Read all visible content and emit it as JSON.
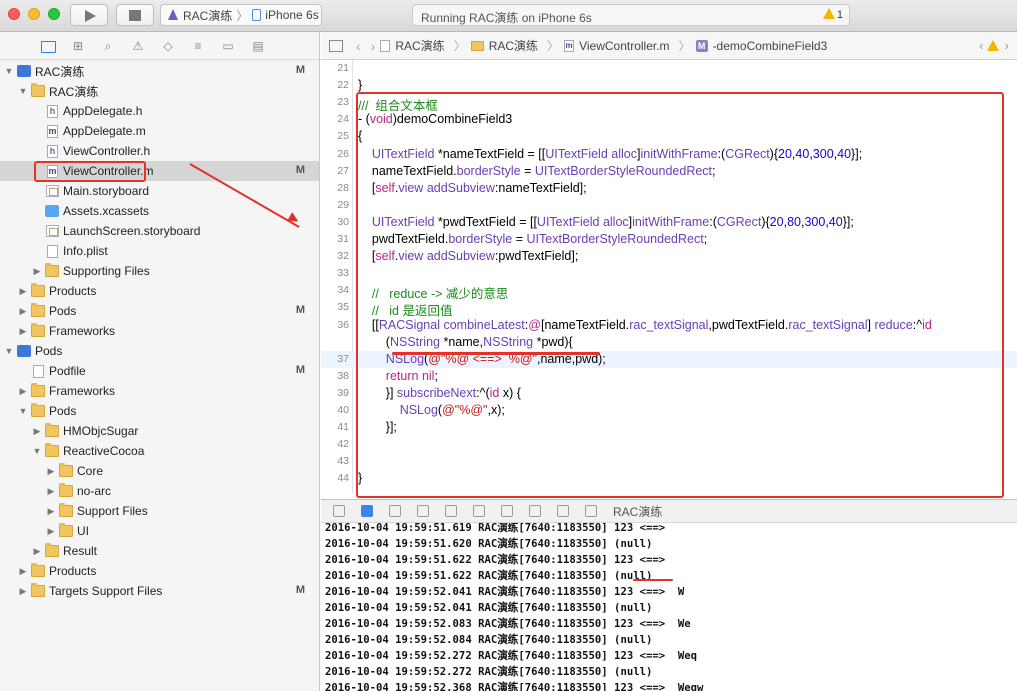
{
  "toolbar": {
    "scheme_target": "RAC演练",
    "scheme_device": "iPhone 6s",
    "status_text": "Running RAC演练 on iPhone 6s",
    "warning_count": "1"
  },
  "navigator": {
    "tree": [
      {
        "label": "RAC演练",
        "indent": 0,
        "icon": "project-icon",
        "disclosure": "▼",
        "badge": "M"
      },
      {
        "label": "RAC演练",
        "indent": 1,
        "icon": "folder-icon",
        "disclosure": "▼",
        "badge": ""
      },
      {
        "label": "AppDelegate.h",
        "indent": 2,
        "icon": "header-file-icon",
        "disclosure": "",
        "badge": ""
      },
      {
        "label": "AppDelegate.m",
        "indent": 2,
        "icon": "objc-file-icon",
        "disclosure": "",
        "badge": ""
      },
      {
        "label": "ViewController.h",
        "indent": 2,
        "icon": "header-file-icon",
        "disclosure": "",
        "badge": ""
      },
      {
        "label": "ViewController.m",
        "indent": 2,
        "icon": "objc-file-icon",
        "disclosure": "",
        "badge": "M",
        "selected": true
      },
      {
        "label": "Main.storyboard",
        "indent": 2,
        "icon": "storyboard-icon",
        "disclosure": "",
        "badge": ""
      },
      {
        "label": "Assets.xcassets",
        "indent": 2,
        "icon": "assets-icon",
        "disclosure": "",
        "badge": ""
      },
      {
        "label": "LaunchScreen.storyboard",
        "indent": 2,
        "icon": "storyboard-icon",
        "disclosure": "",
        "badge": ""
      },
      {
        "label": "Info.plist",
        "indent": 2,
        "icon": "plist-icon",
        "disclosure": "",
        "badge": ""
      },
      {
        "label": "Supporting Files",
        "indent": 2,
        "icon": "folder-icon",
        "disclosure": "▶",
        "badge": ""
      },
      {
        "label": "Products",
        "indent": 1,
        "icon": "folder-icon",
        "disclosure": "▶",
        "badge": ""
      },
      {
        "label": "Pods",
        "indent": 1,
        "icon": "folder-icon",
        "disclosure": "▶",
        "badge": "M"
      },
      {
        "label": "Frameworks",
        "indent": 1,
        "icon": "folder-icon",
        "disclosure": "▶",
        "badge": ""
      },
      {
        "label": "Pods",
        "indent": 0,
        "icon": "project-icon",
        "disclosure": "▼",
        "badge": ""
      },
      {
        "label": "Podfile",
        "indent": 1,
        "icon": "plist-icon",
        "disclosure": "",
        "badge": "M"
      },
      {
        "label": "Frameworks",
        "indent": 1,
        "icon": "folder-icon",
        "disclosure": "▶",
        "badge": ""
      },
      {
        "label": "Pods",
        "indent": 1,
        "icon": "folder-icon",
        "disclosure": "▼",
        "badge": ""
      },
      {
        "label": "HMObjcSugar",
        "indent": 2,
        "icon": "folder-icon",
        "disclosure": "▶",
        "badge": ""
      },
      {
        "label": "ReactiveCocoa",
        "indent": 2,
        "icon": "folder-icon",
        "disclosure": "▼",
        "badge": ""
      },
      {
        "label": "Core",
        "indent": 3,
        "icon": "folder-icon",
        "disclosure": "▶",
        "badge": ""
      },
      {
        "label": "no-arc",
        "indent": 3,
        "icon": "folder-icon",
        "disclosure": "▶",
        "badge": ""
      },
      {
        "label": "Support Files",
        "indent": 3,
        "icon": "folder-icon",
        "disclosure": "▶",
        "badge": ""
      },
      {
        "label": "UI",
        "indent": 3,
        "icon": "folder-icon",
        "disclosure": "▶",
        "badge": ""
      },
      {
        "label": "Result",
        "indent": 2,
        "icon": "folder-icon",
        "disclosure": "▶",
        "badge": ""
      },
      {
        "label": "Products",
        "indent": 1,
        "icon": "folder-icon",
        "disclosure": "▶",
        "badge": ""
      },
      {
        "label": "Targets Support Files",
        "indent": 1,
        "icon": "folder-icon",
        "disclosure": "▶",
        "badge": "M"
      }
    ]
  },
  "jumpbar": {
    "crumb_project": "RAC演练",
    "crumb_folder": "RAC演练",
    "crumb_file": "ViewController.m",
    "crumb_method": "-demoCombineField3",
    "method_badge": "M"
  },
  "editor": {
    "lines": [
      {
        "n": "21",
        "html": ""
      },
      {
        "n": "22",
        "html": "}"
      },
      {
        "n": "23",
        "html": "<span class='cmt'>///  组合文本框</span>"
      },
      {
        "n": "24",
        "html": "- (<span class='kw'>void</span>)demoCombineField3"
      },
      {
        "n": "25",
        "html": "{"
      },
      {
        "n": "26",
        "html": "    <span class='type'>UITextField</span> *nameTextField = [[<span class='type'>UITextField</span> <span class='type'>alloc</span>]<span class='type'>initWithFrame</span>:(<span class='type'>CGRect</span>){<span class='num'>20</span>,<span class='num'>40</span>,<span class='num'>300</span>,<span class='num'>40</span>}];"
      },
      {
        "n": "27",
        "html": "    nameTextField.<span class='type'>borderStyle</span> = <span class='type'>UITextBorderStyleRoundedRect</span>;"
      },
      {
        "n": "28",
        "html": "    [<span class='kw'>self</span>.<span class='type'>view</span> <span class='type'>addSubview</span>:nameTextField];"
      },
      {
        "n": "29",
        "html": ""
      },
      {
        "n": "30",
        "html": "    <span class='type'>UITextField</span> *pwdTextField = [[<span class='type'>UITextField</span> <span class='type'>alloc</span>]<span class='type'>initWithFrame</span>:(<span class='type'>CGRect</span>){<span class='num'>20</span>,<span class='num'>80</span>,<span class='num'>300</span>,<span class='num'>40</span>}];"
      },
      {
        "n": "31",
        "html": "    pwdTextField.<span class='type'>borderStyle</span> = <span class='type'>UITextBorderStyleRoundedRect</span>;"
      },
      {
        "n": "32",
        "html": "    [<span class='kw'>self</span>.<span class='type'>view</span> <span class='type'>addSubview</span>:pwdTextField];"
      },
      {
        "n": "33",
        "html": ""
      },
      {
        "n": "34",
        "html": "    <span class='cmt'>//   reduce -&gt; 减少的意思</span>"
      },
      {
        "n": "35",
        "html": "    <span class='cmt'>//   id 是返回值</span>"
      },
      {
        "n": "36",
        "html": "    [[<span class='type'>RACSignal</span> <span class='type'>combineLatest</span>:<span class='kw'>@</span>[nameTextField.<span class='type'>rac_textSignal</span>,pwdTextField.<span class='type'>rac_textSignal</span>] <span class='type'>reduce</span>:^<span class='kw'>id</span>"
      },
      {
        "n": "",
        "html": "        (<span class='type'>NSString</span> *name,<span class='type'>NSString</span> *pwd){"
      },
      {
        "n": "37",
        "html": "        <span class='type'>NSLog</span>(<span class='str'>@\"%@ &lt;==&gt;  %@\"</span>,name,pwd);",
        "current": true
      },
      {
        "n": "38",
        "html": "        <span class='kw'>return</span> <span class='kw'>nil</span>;"
      },
      {
        "n": "39",
        "html": "        }] <span class='type'>subscribeNext</span>:^(<span class='kw'>id</span> x) {"
      },
      {
        "n": "40",
        "html": "            <span class='type'>NSLog</span>(<span class='str'>@\"%@\"</span>,x);"
      },
      {
        "n": "41",
        "html": "        }];"
      },
      {
        "n": "42",
        "html": ""
      },
      {
        "n": "43",
        "html": ""
      },
      {
        "n": "44",
        "html": "}"
      }
    ]
  },
  "debug": {
    "target_label": "RAC演练",
    "log": [
      "2016-10-04 19:59:51.619 RAC演练[7640:1183550] 123 <==>",
      "2016-10-04 19:59:51.620 RAC演练[7640:1183550] (null)",
      "2016-10-04 19:59:51.622 RAC演练[7640:1183550] 123 <==>",
      "2016-10-04 19:59:51.622 RAC演练[7640:1183550] (null)",
      "2016-10-04 19:59:52.041 RAC演练[7640:1183550] 123 <==>  W",
      "2016-10-04 19:59:52.041 RAC演练[7640:1183550] (null)",
      "2016-10-04 19:59:52.083 RAC演练[7640:1183550] 123 <==>  We",
      "2016-10-04 19:59:52.084 RAC演练[7640:1183550] (null)",
      "2016-10-04 19:59:52.272 RAC演练[7640:1183550] 123 <==>  Weq",
      "2016-10-04 19:59:52.272 RAC演练[7640:1183550] (null)",
      "2016-10-04 19:59:52.368 RAC演练[7640:1183550] 123 <==>  Weqw"
    ]
  }
}
